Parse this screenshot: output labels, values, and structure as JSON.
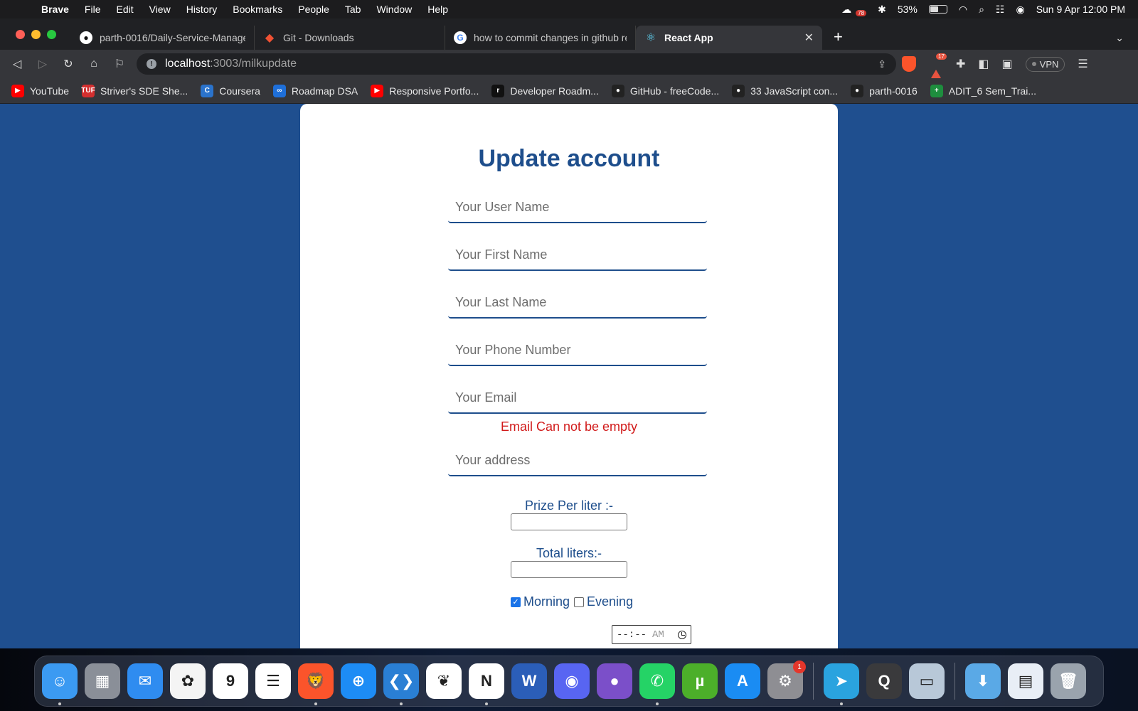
{
  "menubar": {
    "app_name": "Brave",
    "items": [
      "File",
      "Edit",
      "View",
      "History",
      "Bookmarks",
      "People",
      "Tab",
      "Window",
      "Help"
    ],
    "status_badge": "78",
    "battery_percent": "53%",
    "battery_level": 0.53,
    "datetime": "Sun 9 Apr  12:00 PM"
  },
  "tabs": [
    {
      "title": "parth-0016/Daily-Service-Managem",
      "icon": "github-icon",
      "active": false
    },
    {
      "title": "Git - Downloads",
      "icon": "git-icon",
      "active": false
    },
    {
      "title": "how to commit changes in github re",
      "icon": "google-icon",
      "active": false
    },
    {
      "title": "React App",
      "icon": "react-icon",
      "active": true
    }
  ],
  "toolbar": {
    "url_host": "localhost",
    "url_path": ":3003/milkupdate",
    "rewards_count": "17",
    "vpn_label": "VPN"
  },
  "bookmarks": [
    {
      "label": "YouTube",
      "icon": "youtube-icon",
      "color": "#ff0000",
      "glyph": "▶"
    },
    {
      "label": "Striver's SDE She...",
      "icon": "tuf-icon",
      "color": "#d32f2f",
      "glyph": "TUF"
    },
    {
      "label": "Coursera",
      "icon": "coursera-icon",
      "color": "#2a73cc",
      "glyph": "C"
    },
    {
      "label": "Roadmap DSA",
      "icon": "infinity-icon",
      "color": "#1e6fd9",
      "glyph": "∞"
    },
    {
      "label": "Responsive Portfo...",
      "icon": "youtube-icon",
      "color": "#ff0000",
      "glyph": "▶"
    },
    {
      "label": "Developer Roadm...",
      "icon": "roadmap-icon",
      "color": "#111111",
      "glyph": "r"
    },
    {
      "label": "GitHub - freeCode...",
      "icon": "github-icon",
      "color": "#222222",
      "glyph": "●"
    },
    {
      "label": "33 JavaScript con...",
      "icon": "github-icon",
      "color": "#222222",
      "glyph": "●"
    },
    {
      "label": "parth-0016",
      "icon": "github-icon",
      "color": "#222222",
      "glyph": "●"
    },
    {
      "label": "ADIT_6 Sem_Trai...",
      "icon": "sheets-icon",
      "color": "#1e8e3e",
      "glyph": "+"
    }
  ],
  "form": {
    "title": "Update account",
    "username_placeholder": "Your User Name",
    "firstname_placeholder": "Your First Name",
    "lastname_placeholder": "Your Last Name",
    "phone_placeholder": "Your Phone Number",
    "email_placeholder": "Your Email",
    "email_error": "Email Can not be empty",
    "address_placeholder": "Your address",
    "price_label": "Prize Per liter :-",
    "liters_label": "Total liters:-",
    "morning_label": "Morning",
    "morning_checked": true,
    "evening_label": "Evening",
    "evening_checked": false,
    "time_placeholder": "--:--",
    "time_ampm": "AM"
  },
  "dock": [
    {
      "name": "finder-icon",
      "color": "#3b9af2",
      "glyph": "☺"
    },
    {
      "name": "launchpad-icon",
      "color": "#8a8f98",
      "glyph": "▦"
    },
    {
      "name": "mail-icon",
      "color": "#2f8cf0",
      "glyph": "✉"
    },
    {
      "name": "photos-icon",
      "color": "#f4f4f4",
      "glyph": "✿"
    },
    {
      "name": "calendar-icon",
      "color": "#ffffff",
      "glyph": "9"
    },
    {
      "name": "reminders-icon",
      "color": "#ffffff",
      "glyph": "☰"
    },
    {
      "name": "brave-icon",
      "color": "#fb542b",
      "glyph": "🦁"
    },
    {
      "name": "safari-icon",
      "color": "#1d8cf5",
      "glyph": "⊕"
    },
    {
      "name": "vscode-icon",
      "color": "#2a7fd4",
      "glyph": "❮❯"
    },
    {
      "name": "mongodb-icon",
      "color": "#ffffff",
      "glyph": "❦"
    },
    {
      "name": "notion-icon",
      "color": "#ffffff",
      "glyph": "N"
    },
    {
      "name": "word-icon",
      "color": "#2b5eb8",
      "glyph": "W"
    },
    {
      "name": "discord-icon",
      "color": "#5865f2",
      "glyph": "◉"
    },
    {
      "name": "github-desktop-icon",
      "color": "#7b4fc9",
      "glyph": "●"
    },
    {
      "name": "whatsapp-icon",
      "color": "#25d366",
      "glyph": "✆"
    },
    {
      "name": "utorrent-icon",
      "color": "#4caf2a",
      "glyph": "µ"
    },
    {
      "name": "app-store-icon",
      "color": "#1a8cf3",
      "glyph": "A"
    },
    {
      "name": "system-settings-icon",
      "color": "#8e8e93",
      "glyph": "⚙",
      "badge": "1"
    },
    {
      "name": "telegram-icon",
      "color": "#2aa3df",
      "glyph": "➤"
    },
    {
      "name": "quicktime-icon",
      "color": "#3a3a3c",
      "glyph": "Q"
    },
    {
      "name": "preview-icon",
      "color": "#b8c8d8",
      "glyph": "▭"
    },
    {
      "name": "downloads-folder-icon",
      "color": "#5aa9e6",
      "glyph": "⬇"
    },
    {
      "name": "recent-doc-icon",
      "color": "#e8eef6",
      "glyph": "▤"
    },
    {
      "name": "trash-icon",
      "color": "#9aa3ad",
      "glyph": "🗑"
    }
  ]
}
